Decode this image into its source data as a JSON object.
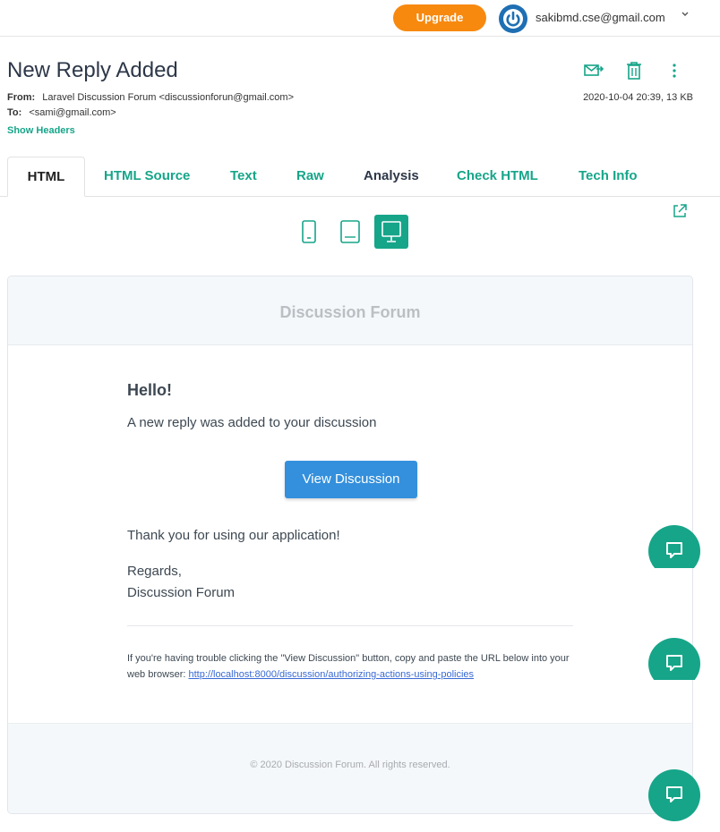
{
  "topbar": {
    "upgrade_label": "Upgrade",
    "account_email": "sakibmd.cse@gmail.com",
    "chevron": "⌄"
  },
  "message": {
    "subject": "New Reply Added",
    "from_label": "From:",
    "from_value": "Laravel Discussion Forum <discussionforun@gmail.com>",
    "to_label": "To:",
    "to_value": "<sami@gmail.com>",
    "show_headers": "Show Headers",
    "date_size": "2020-10-04 20:39, 13 KB"
  },
  "actions": {
    "icons": [
      "forward-email-icon",
      "trash-icon",
      "more-vertical-icon"
    ]
  },
  "tabs": [
    {
      "label": "HTML",
      "active": true
    },
    {
      "label": "HTML Source"
    },
    {
      "label": "Text"
    },
    {
      "label": "Raw"
    },
    {
      "label": "Analysis"
    },
    {
      "label": "Check HTML"
    },
    {
      "label": "Tech Info"
    }
  ],
  "devices": [
    "mobile-icon",
    "tablet-icon",
    "desktop-icon"
  ],
  "email": {
    "header_title": "Discussion Forum",
    "greeting": "Hello!",
    "line1": "A new reply was added to your discussion",
    "button_label": "View Discussion",
    "line2": "Thank you for using our application!",
    "regards": "Regards,",
    "signature": "Discussion Forum",
    "subcopy_text": "If you're having trouble clicking the \"View Discussion\" button, copy and paste the URL below into your web browser:",
    "subcopy_link": "http://localhost:8000/discussion/authorizing-actions-using-policies",
    "footer": "© 2020 Discussion Forum. All rights reserved."
  },
  "colors": {
    "accent": "#16a589",
    "upgrade": "#f7890f",
    "button": "#3490dc"
  }
}
